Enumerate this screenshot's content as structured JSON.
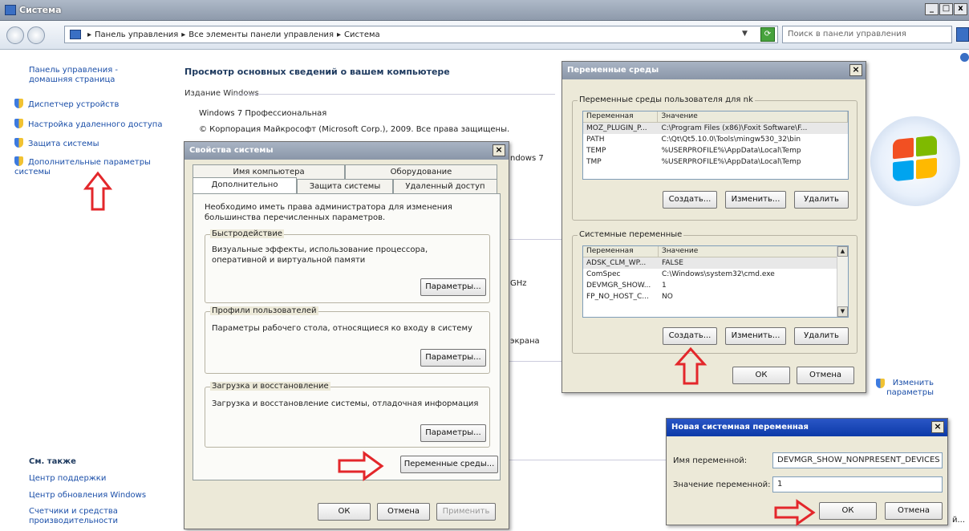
{
  "window": {
    "title": "Система",
    "caption_buttons": [
      "_",
      "□",
      "x"
    ]
  },
  "addressbar": {
    "breadcrumb": [
      "Панель управления",
      "Все элементы панели управления",
      "Система"
    ],
    "separator": "▸",
    "search_placeholder": "Поиск в панели управления"
  },
  "sidebar": {
    "home_link": "Панель управления - домашняя страница",
    "links": [
      "Диспетчер устройств",
      "Настройка удаленного доступа",
      "Защита системы",
      "Дополнительные параметры системы"
    ],
    "see_also_title": "См. также",
    "see_also": [
      "Центр поддержки",
      "Центр обновления Windows",
      "Счетчики и средства производительности"
    ]
  },
  "main": {
    "heading": "Просмотр основных сведений о вашем компьютере",
    "edition_label": "Издание Windows",
    "edition": "Windows 7 Профессиональная",
    "copyright": "© Корпорация Майкрософт (Microsoft Corp.), 2009. Все права защищены.",
    "partial_labels": [
      "ndows 7",
      "GHz",
      "экрана"
    ],
    "change_settings": "Изменить параметры",
    "partial_right": "й..."
  },
  "sysprops": {
    "title": "Свойства системы",
    "tabs_row1": [
      "Имя компьютера",
      "Оборудование"
    ],
    "tabs_row2": [
      "Дополнительно",
      "Защита системы",
      "Удаленный доступ"
    ],
    "admin_note": "Необходимо иметь права администратора для изменения большинства перечисленных параметров.",
    "groups": [
      {
        "label": "Быстродействие",
        "text": "Визуальные эффекты, использование процессора, оперативной и виртуальной памяти",
        "button": "Параметры..."
      },
      {
        "label": "Профили пользователей",
        "text": "Параметры рабочего стола, относящиеся ко входу в систему",
        "button": "Параметры..."
      },
      {
        "label": "Загрузка и восстановление",
        "text": "Загрузка и восстановление системы, отладочная информация",
        "button": "Параметры..."
      }
    ],
    "env_button": "Переменные среды...",
    "ok": "ОК",
    "cancel": "Отмена",
    "apply": "Применить"
  },
  "envvars": {
    "title": "Переменные среды",
    "user_group": "Переменные среды пользователя для nk",
    "columns": [
      "Переменная",
      "Значение"
    ],
    "user_rows": [
      {
        "name": "MOZ_PLUGIN_P...",
        "value": "C:\\Program Files (x86)\\Foxit Software\\F..."
      },
      {
        "name": "PATH",
        "value": "C:\\Qt\\Qt5.10.0\\Tools\\mingw530_32\\bin"
      },
      {
        "name": "TEMP",
        "value": "%USERPROFILE%\\AppData\\Local\\Temp"
      },
      {
        "name": "TMP",
        "value": "%USERPROFILE%\\AppData\\Local\\Temp"
      }
    ],
    "system_group": "Системные переменные",
    "system_rows": [
      {
        "name": "ADSK_CLM_WP...",
        "value": "FALSE"
      },
      {
        "name": "ComSpec",
        "value": "C:\\Windows\\system32\\cmd.exe"
      },
      {
        "name": "DEVMGR_SHOW...",
        "value": "1"
      },
      {
        "name": "FP_NO_HOST_C...",
        "value": "NO"
      }
    ],
    "create": "Создать...",
    "edit": "Изменить...",
    "delete": "Удалить",
    "ok": "ОК",
    "cancel": "Отмена"
  },
  "newvar": {
    "title": "Новая системная переменная",
    "name_label": "Имя переменной:",
    "name_value": "DEVMGR_SHOW_NONPRESENT_DEVICES",
    "value_label": "Значение переменной:",
    "value_value": "1",
    "ok": "ОК",
    "cancel": "Отмена"
  }
}
